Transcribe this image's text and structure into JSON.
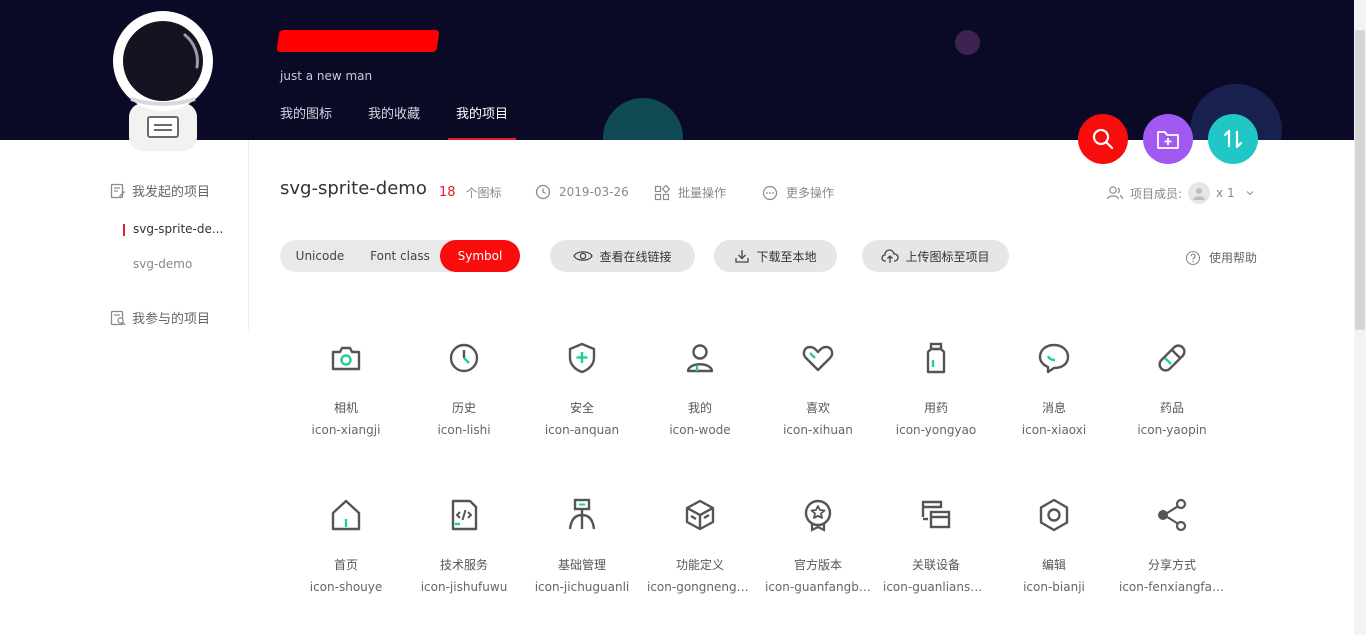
{
  "header": {
    "bio": "just a new man",
    "nav_tabs": [
      {
        "label": "我的图标",
        "active": false
      },
      {
        "label": "我的收藏",
        "active": false
      },
      {
        "label": "我的项目",
        "active": true
      }
    ],
    "fabs": [
      {
        "name": "search",
        "icon": "search-icon",
        "color": "#f80c0c"
      },
      {
        "name": "add-folder",
        "icon": "folder-plus-icon",
        "color": "#a259f2"
      },
      {
        "name": "sort",
        "icon": "sort-arrows-icon",
        "color": "#21c7c6"
      }
    ]
  },
  "sidebar": {
    "created_heading": "我发起的项目",
    "created_items": [
      {
        "label": "svg-sprite-de...",
        "active": true
      },
      {
        "label": "svg-demo",
        "active": false
      }
    ],
    "joined_heading": "我参与的项目"
  },
  "project": {
    "title": "svg-sprite-demo",
    "icon_count": "18",
    "icon_count_label": "个图标",
    "date": "2019-03-26",
    "batch_label": "批量操作",
    "more_label": "更多操作",
    "members_label": "项目成员:",
    "members_count": "x 1"
  },
  "toolbar": {
    "segments": [
      {
        "label": "Unicode",
        "active": false
      },
      {
        "label": "Font class",
        "active": false
      },
      {
        "label": "Symbol",
        "active": true
      }
    ],
    "view_link_label": "查看在线链接",
    "download_label": "下载至本地",
    "upload_label": "上传图标至项目",
    "help_label": "使用帮助"
  },
  "icons": [
    {
      "name": "相机",
      "code": "icon-xiangji",
      "glyph": "camera-icon"
    },
    {
      "name": "历史",
      "code": "icon-lishi",
      "glyph": "clock-icon"
    },
    {
      "name": "安全",
      "code": "icon-anquan",
      "glyph": "shield-icon"
    },
    {
      "name": "我的",
      "code": "icon-wode",
      "glyph": "user-icon"
    },
    {
      "name": "喜欢",
      "code": "icon-xihuan",
      "glyph": "heart-icon"
    },
    {
      "name": "用药",
      "code": "icon-yongyao",
      "glyph": "medicine-bottle-icon"
    },
    {
      "name": "消息",
      "code": "icon-xiaoxi",
      "glyph": "chat-bubble-icon"
    },
    {
      "name": "药品",
      "code": "icon-yaopin",
      "glyph": "pill-icon"
    },
    {
      "name": "首页",
      "code": "icon-shouye",
      "glyph": "home-icon"
    },
    {
      "name": "技术服务",
      "code": "icon-jishufuwu",
      "glyph": "code-file-icon"
    },
    {
      "name": "基础管理",
      "code": "icon-jichuguanli",
      "glyph": "hierarchy-icon"
    },
    {
      "name": "功能定义",
      "code": "icon-gongnengdi...",
      "glyph": "cube-icon"
    },
    {
      "name": "官方版本",
      "code": "icon-guanfangba...",
      "glyph": "badge-icon"
    },
    {
      "name": "关联设备",
      "code": "icon-guanlianshe...",
      "glyph": "devices-icon"
    },
    {
      "name": "编辑",
      "code": "icon-bianji",
      "glyph": "hex-nut-icon"
    },
    {
      "name": "分享方式",
      "code": "icon-fenxiangfan...",
      "glyph": "share-icon"
    }
  ],
  "colors": {
    "header_bg": "#0b0a26",
    "accent_red": "#f80c0c",
    "icon_stroke": "#555555",
    "icon_accent": "#1fcf9a"
  }
}
